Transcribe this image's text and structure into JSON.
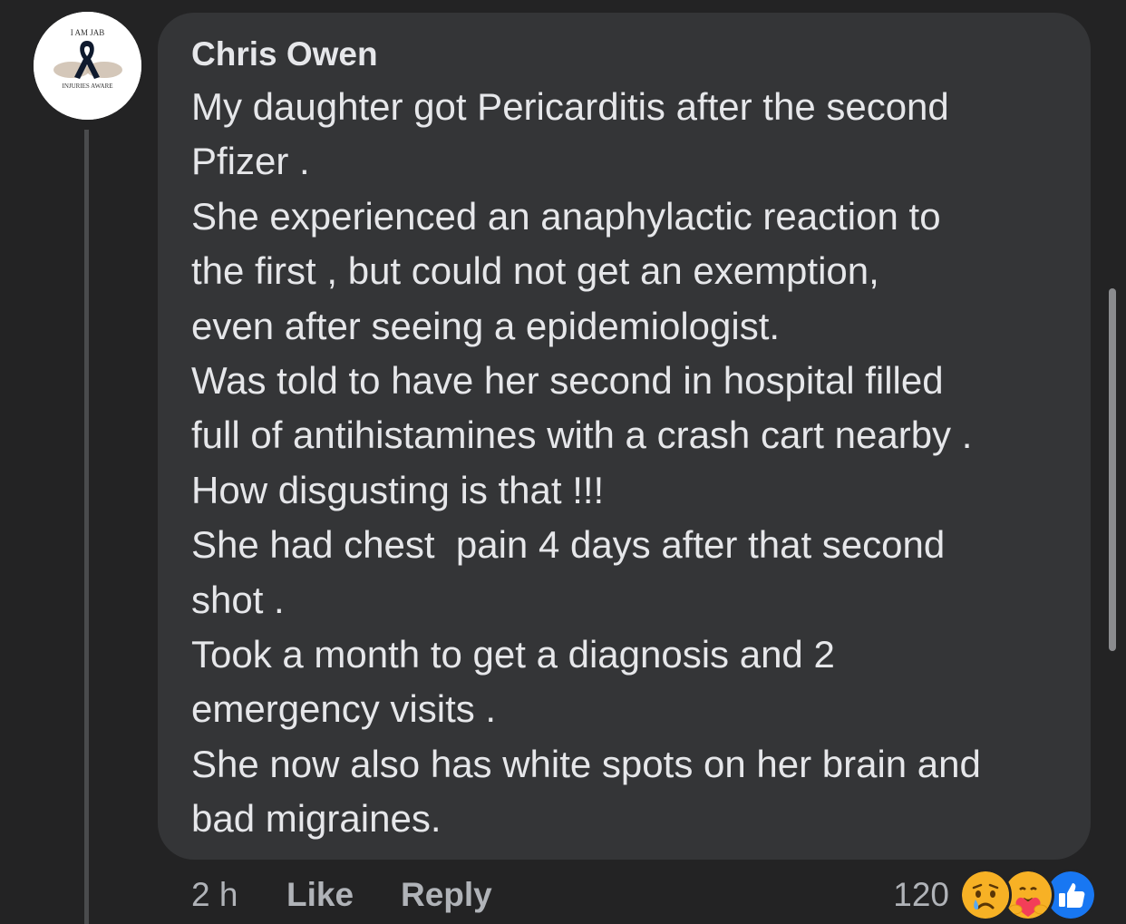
{
  "comment": {
    "author": "Chris Owen",
    "avatar": {
      "text_top": "I AM JAB",
      "text_bottom": "INJURIES AWARE"
    },
    "lines": [
      "My daughter got Pericarditis after the second",
      "Pfizer .",
      "She experienced an anaphylactic reaction to",
      "the first , but could not get an exemption,",
      "even after seeing a epidemiologist.",
      "Was told to have her second in hospital filled",
      "full of antihistamines with a crash cart nearby .",
      "How disgusting is that !!!",
      "She had chest  pain 4 days after that second",
      "shot .",
      "Took a month to get a diagnosis and 2",
      "emergency visits .",
      "She now also has white spots on her brain and",
      "bad migraines."
    ]
  },
  "actions": {
    "time": "2 h",
    "like_label": "Like",
    "reply_label": "Reply"
  },
  "reactions": {
    "count": "120",
    "icons": [
      "sad-icon",
      "care-icon",
      "like-icon"
    ]
  },
  "colors": {
    "background": "#232324",
    "bubble": "#343537",
    "text": "#e6e7ea",
    "secondary_text": "#b0b3b8",
    "like_blue": "#1877f2"
  }
}
